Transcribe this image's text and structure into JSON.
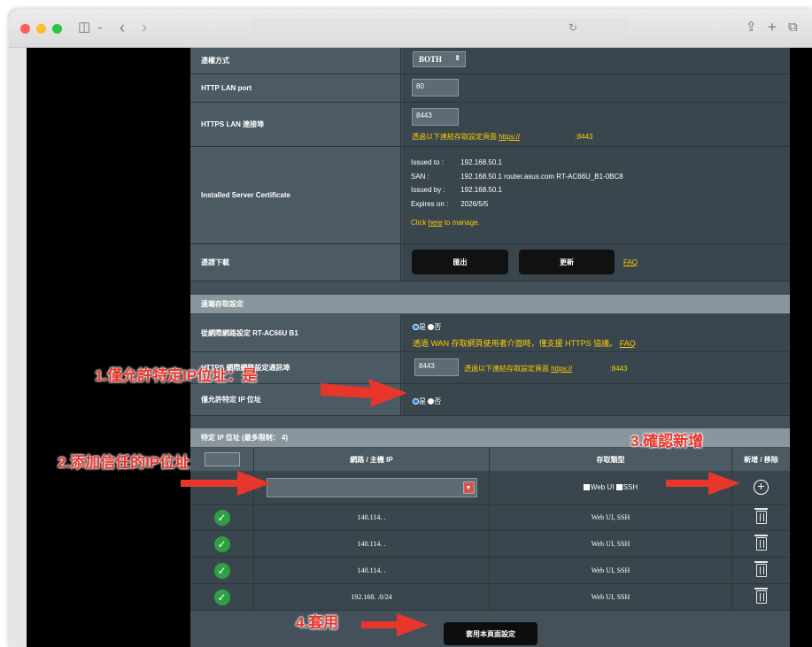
{
  "browser": {
    "url_text": "",
    "colors": {
      "close": "#ff5f57",
      "minimize": "#febc2e",
      "zoom": "#28c840"
    },
    "icons": [
      "sidebar-icon",
      "chevron-down-icon",
      "back-icon",
      "forward-icon",
      "reload-icon",
      "share-icon",
      "new-tab-icon",
      "tabs-overview-icon"
    ]
  },
  "settings": {
    "auth_method": {
      "label": "憑權方式",
      "value": "BOTH"
    },
    "http_port": {
      "label": "HTTP LAN port",
      "value": "80"
    },
    "https_port": {
      "label": "HTTPS LAN 連接埠",
      "value": "8443",
      "hint_prefix": "透過以下連結存取設定頁面",
      "hint_link": "https://",
      "hint_suffix": ":8443"
    },
    "certificate": {
      "label": "Installed Server Certificate",
      "issued_to_key": "Issued to :",
      "issued_to": "192.168.50.1",
      "san_key": "SAN :",
      "san": "192.168.50.1 router.asus.com RT-AC66U_B1-0BC8",
      "issued_by_key": "Issued by :",
      "issued_by": "192.168.50.1",
      "expires_key": "Expires on :",
      "expires": "2026/5/5",
      "manage_prefix": "Click ",
      "manage_link": "here",
      "manage_suffix": " to manage."
    },
    "cert_download": {
      "label": "憑證下載",
      "export": "匯出",
      "renew": "更新",
      "faq": "FAQ"
    }
  },
  "remote_section": {
    "title": "遠端存取設定",
    "wan_access": {
      "label": "從網際網路設定 RT-AC66U B1",
      "yes": "是",
      "no": "否",
      "note": "透過 WAN 存取網頁使用者介面時，僅支援 HTTPS 協議。",
      "faq": "FAQ"
    },
    "wan_port": {
      "label": "HTTPS 網際網路設定通訊埠",
      "value": "8443",
      "hint_prefix": "透過以下連結存取設定頁面",
      "hint_link": "https://",
      "hint_suffix": ":8443"
    },
    "allow_specific": {
      "label": "僅允許特定 IP 位址",
      "yes": "是",
      "no": "否"
    }
  },
  "ip_section": {
    "title": "特定 IP 位址 (最多限制： 4)",
    "col_ip": "網路 / 主機 IP",
    "col_type": "存取類型",
    "col_action": "新增 / 移除",
    "add_row": {
      "ip_value": "",
      "web_ui": "Web UI",
      "ssh": "SSH"
    },
    "rows": [
      {
        "ip": "140.114.  .",
        "type": "Web UI, SSH"
      },
      {
        "ip": "140.114.  .",
        "type": "Web UI, SSH"
      },
      {
        "ip": "140.114.  .",
        "type": "Web UI, SSH"
      },
      {
        "ip": "192.168.  .0/24",
        "type": "Web UI, SSH"
      }
    ]
  },
  "apply_button": "套用本頁面設定",
  "annotations": {
    "step1": "1.僅允許特定IP位址：是",
    "step2": "2.添加信任的IP位址",
    "step3": "3.確認新增",
    "step4": "4.套用",
    "color": "#e8362b"
  }
}
